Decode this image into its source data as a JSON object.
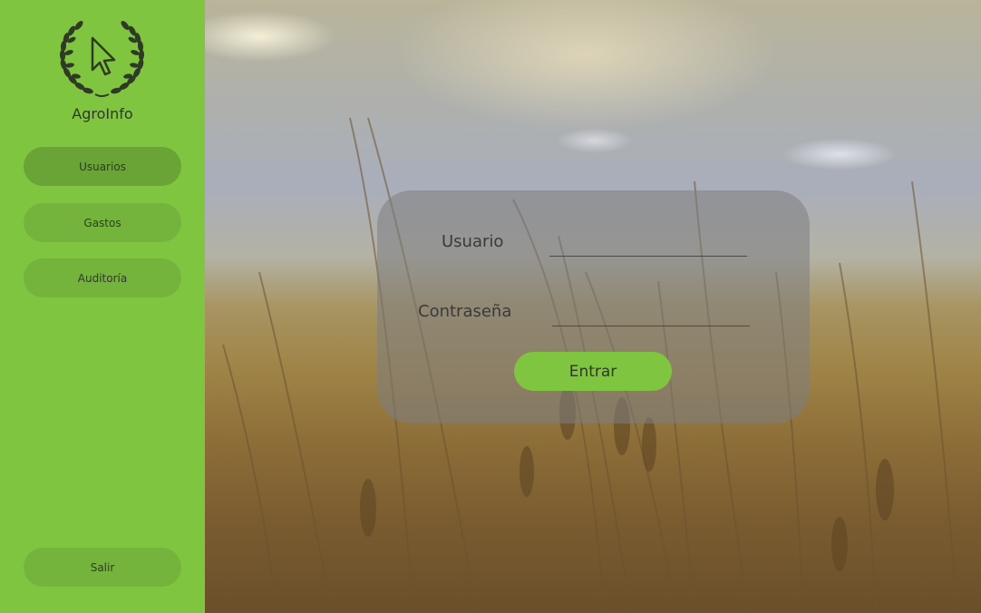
{
  "sidebar": {
    "brand": "AgroInfo",
    "logo_icon": "laurel-cursor-icon",
    "nav": {
      "usuarios": "Usuarios",
      "gastos": "Gastos",
      "auditoria": "Auditoría",
      "salir": "Salir"
    },
    "active_item": "usuarios"
  },
  "login": {
    "usuario_label": "Usuario",
    "usuario_value": "",
    "password_label": "Contraseña",
    "password_value": "",
    "submit_label": "Entrar"
  },
  "colors": {
    "sidebar": "#80c540",
    "nav_button": "#74b43c",
    "submit_button": "#80c540"
  }
}
